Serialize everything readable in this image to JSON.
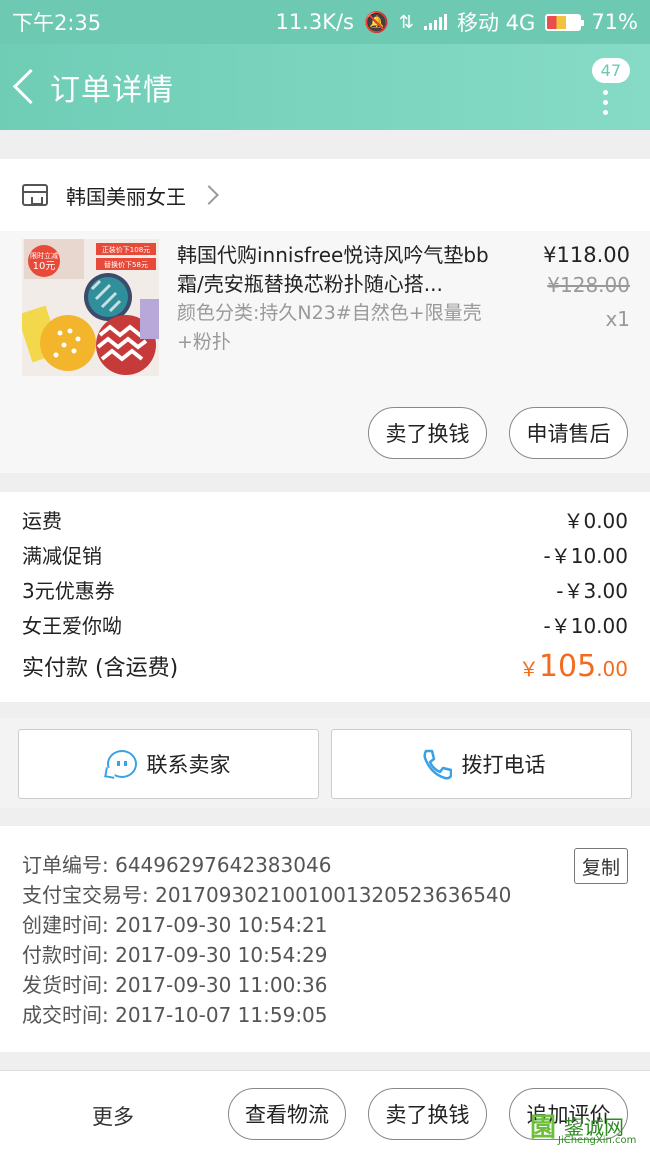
{
  "status_bar": {
    "time": "下午2:35",
    "speed": "11.3K/s",
    "carrier": "移动 4G",
    "battery": "71%"
  },
  "header": {
    "title": "订单详情",
    "badge_count": "47"
  },
  "shop": {
    "name": "韩国美丽女王"
  },
  "product": {
    "name": "韩国代购innisfree悦诗风吟气垫bb霜/壳安瓶替换芯粉扑随心搭...",
    "variant": "颜色分类:持久N23#自然色+限量壳+粉扑",
    "price": "¥118.00",
    "original_price": "¥128.00",
    "quantity": "x1",
    "thumb_badge": "限时立减10元",
    "thumb_line1": "正装价下108元",
    "thumb_line2": "替换价下58元",
    "actions": {
      "resell": "卖了换钱",
      "after_sale": "申请售后"
    }
  },
  "fees": {
    "rows": [
      {
        "label": "运费",
        "value": "￥0.00"
      },
      {
        "label": "满减促销",
        "value": "-￥10.00"
      },
      {
        "label": "3元优惠券",
        "value": "-￥3.00"
      },
      {
        "label": "女王爱你呦",
        "value": "-￥10.00"
      }
    ],
    "total_label": "实付款 (含运费)",
    "total_symbol": "￥",
    "total_int": "105",
    "total_dec": ".00"
  },
  "contact": {
    "seller": "联系卖家",
    "call": "拨打电话"
  },
  "order_info": {
    "order_no": "订单编号: 64496297642383046",
    "alipay_no": "支付宝交易号: 2017093021001001320523636540",
    "created": "创建时间: 2017-09-30 10:54:21",
    "paid": "付款时间: 2017-09-30 10:54:29",
    "shipped": "发货时间: 2017-09-30 11:00:36",
    "completed": "成交时间: 2017-10-07 11:59:05",
    "copy_label": "复制"
  },
  "bottom": {
    "more": "更多",
    "logistics": "查看物流",
    "resell": "卖了换钱",
    "review": "追加评价"
  },
  "watermark": {
    "cn": "鋆诚网",
    "en": "JiChengXin.com"
  }
}
